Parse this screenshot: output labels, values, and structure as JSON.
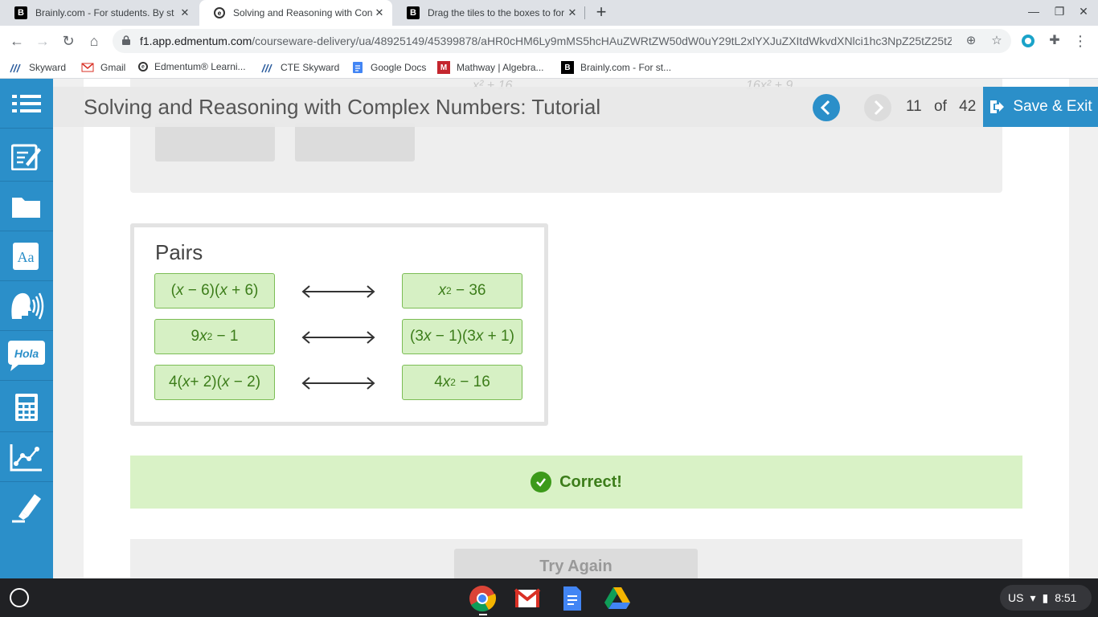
{
  "browser": {
    "tabs": [
      {
        "title": "Brainly.com - For students. By st",
        "favicon": "brainly-icon"
      },
      {
        "title": "Solving and Reasoning with Con",
        "favicon": "edmentum-icon",
        "active": true
      },
      {
        "title": "Drag the tiles to the boxes to for",
        "favicon": "brainly-icon"
      }
    ],
    "new_tab": "+",
    "url_host": "f1.app.edmentum.com",
    "url_path": "/courseware-delivery/ua/48925149/45399878/aHR0cHM6Ly9mMS5hcHAuZWRtZW50dW0uY29tL2xlYXJuZXItdWkvdXNlci1hc3NpZ25tZ25tZ25tZ25t..."
  },
  "bookmarks": [
    {
      "label": "Skyward",
      "icon": "skyward-icon"
    },
    {
      "label": "Gmail",
      "icon": "gmail-icon"
    },
    {
      "label": "Edmentum® Learni...",
      "icon": "edmentum-icon"
    },
    {
      "label": "CTE Skyward",
      "icon": "skyward-icon"
    },
    {
      "label": "Google Docs",
      "icon": "docs-icon"
    },
    {
      "label": "Mathway | Algebra...",
      "icon": "mathway-icon"
    },
    {
      "label": "Brainly.com - For st...",
      "icon": "brainly-icon"
    }
  ],
  "header": {
    "title": "Solving and Reasoning with Complex Numbers: Tutorial",
    "page_current": "11",
    "page_of": "of",
    "page_total": "42",
    "save_exit": "Save & Exit"
  },
  "faded": {
    "left": "x² + 16",
    "right": "16x² + 9"
  },
  "pairs": {
    "title": "Pairs",
    "rows": [
      {
        "left": "(x − 6)(x + 6)",
        "right": "x² − 36"
      },
      {
        "left": "9x² − 1",
        "right": "(3x − 1)(3x + 1)"
      },
      {
        "left": "4(x+ 2)(x − 2)",
        "right": "4x² − 16"
      }
    ]
  },
  "feedback": {
    "text": "Correct!"
  },
  "actions": {
    "try_again": "Try Again"
  },
  "system": {
    "locale": "US",
    "time": "8:51"
  },
  "colors": {
    "accent": "#2b8fc9",
    "correct_bg": "#d9f2c6",
    "correct_text": "#3c7d1a"
  }
}
